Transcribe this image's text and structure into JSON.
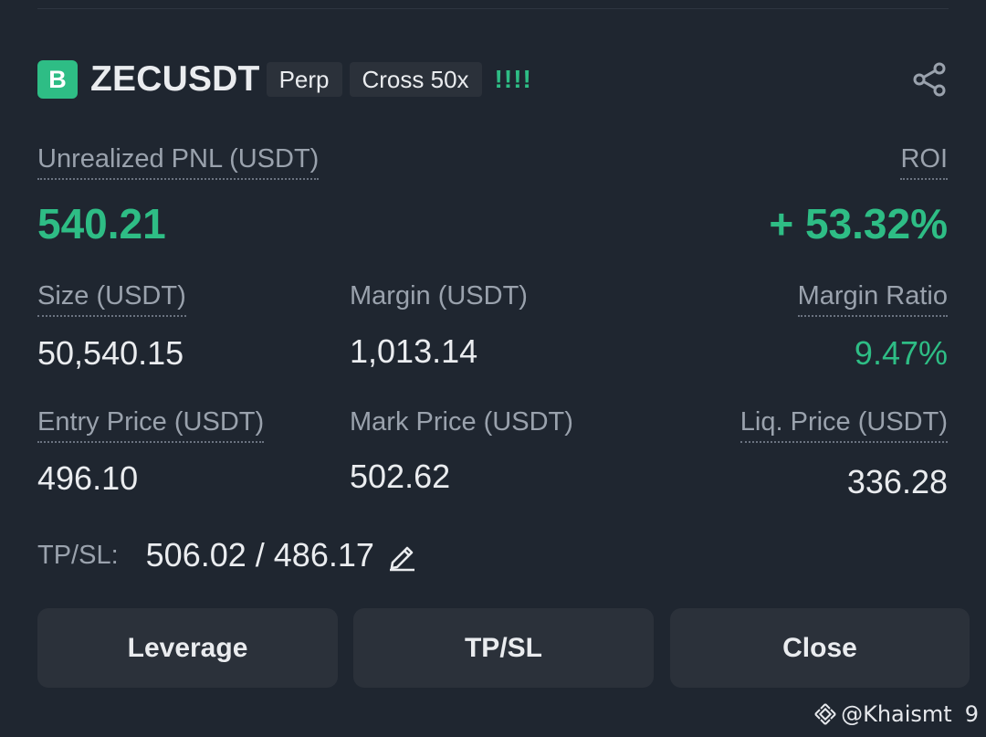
{
  "header": {
    "badge": "B",
    "symbol": "ZECUSDT",
    "type_tag": "Perp",
    "margin_tag": "Cross 50x",
    "signal": "!!!!"
  },
  "pnl": {
    "label": "Unrealized PNL (USDT)",
    "value": "540.21",
    "roi_label": "ROI",
    "roi_value": "+ 53.32%"
  },
  "stats": {
    "size_label": "Size (USDT)",
    "size_value": "50,540.15",
    "margin_label": "Margin (USDT)",
    "margin_value": "1,013.14",
    "margin_ratio_label": "Margin Ratio",
    "margin_ratio_value": "9.47%",
    "entry_label": "Entry Price (USDT)",
    "entry_value": "496.10",
    "mark_label": "Mark Price (USDT)",
    "mark_value": "502.62",
    "liq_label": "Liq. Price (USDT)",
    "liq_value": "336.28"
  },
  "tpsl": {
    "label": "TP/SL:",
    "value": "506.02 / 486.17"
  },
  "buttons": {
    "leverage": "Leverage",
    "tpsl": "TP/SL",
    "close": "Close"
  },
  "watermark": {
    "handle": "@Khaismt",
    "suffix": "9"
  },
  "colors": {
    "background": "#1f2630",
    "accent_green": "#2ebd85",
    "button_bg": "#2b313a",
    "label_gray": "#9aa2ad"
  },
  "icons": {
    "share": "share-icon",
    "edit": "pencil-icon",
    "watermark_logo": "binance-logo-icon"
  }
}
